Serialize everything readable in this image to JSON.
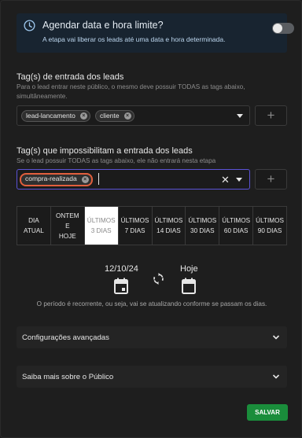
{
  "alert": {
    "title": "Agendar data e hora limite?",
    "description": "A etapa vai liberar os leads até uma data e hora determinada.",
    "icon": "clock-icon",
    "toggle_on": false
  },
  "entry_tags": {
    "label": "Tag(s) de entrada dos leads",
    "hint_line1": "Para o lead entrar neste público, o mesmo deve possuir TODAS as tags abaixo,",
    "hint_line2": "simultâneamente.",
    "chips": [
      "lead-lancamento",
      "cliente"
    ],
    "add_label": "+"
  },
  "block_tags": {
    "label": "Tag(s) que impossibilitam a entrada dos leads",
    "hint": "Se o lead possuir TODAS as tags abaixo, ele não entrará nesta etapa",
    "chips": [
      "compra-realizada"
    ],
    "clear_label": "✕",
    "add_label": "+"
  },
  "range": {
    "options": [
      {
        "l1": "DIA",
        "l2": "ATUAL",
        "l3": ""
      },
      {
        "l1": "ONTEM",
        "l2": "E",
        "l3": "HOJE"
      },
      {
        "l1": "ÚLTIMOS",
        "l2": "3 DIAS",
        "l3": ""
      },
      {
        "l1": "ÚLTIMOS",
        "l2": "7 DIAS",
        "l3": ""
      },
      {
        "l1": "ÚLTIMOS",
        "l2": "14 DIAS",
        "l3": ""
      },
      {
        "l1": "ÚLTIMOS",
        "l2": "30 DIAS",
        "l3": ""
      },
      {
        "l1": "ÚLTIMOS",
        "l2": "60 DIAS",
        "l3": ""
      },
      {
        "l1": "ÚLTIMOS",
        "l2": "90 DIAS",
        "l3": ""
      }
    ],
    "active_index": 2
  },
  "period": {
    "start": "12/10/24",
    "end": "Hoje",
    "note": "O período é recorrente, ou seja, vai se atualizando conforme se passam os dias."
  },
  "accordions": [
    "Configurações avançadas",
    "Saiba mais sobre o Público"
  ],
  "save_label": "SALVAR",
  "colors": {
    "accent": "#5b53d6",
    "selected_chip_border": "#e25f3d",
    "save": "#1a8d3b",
    "alert_bg": "#182430"
  }
}
